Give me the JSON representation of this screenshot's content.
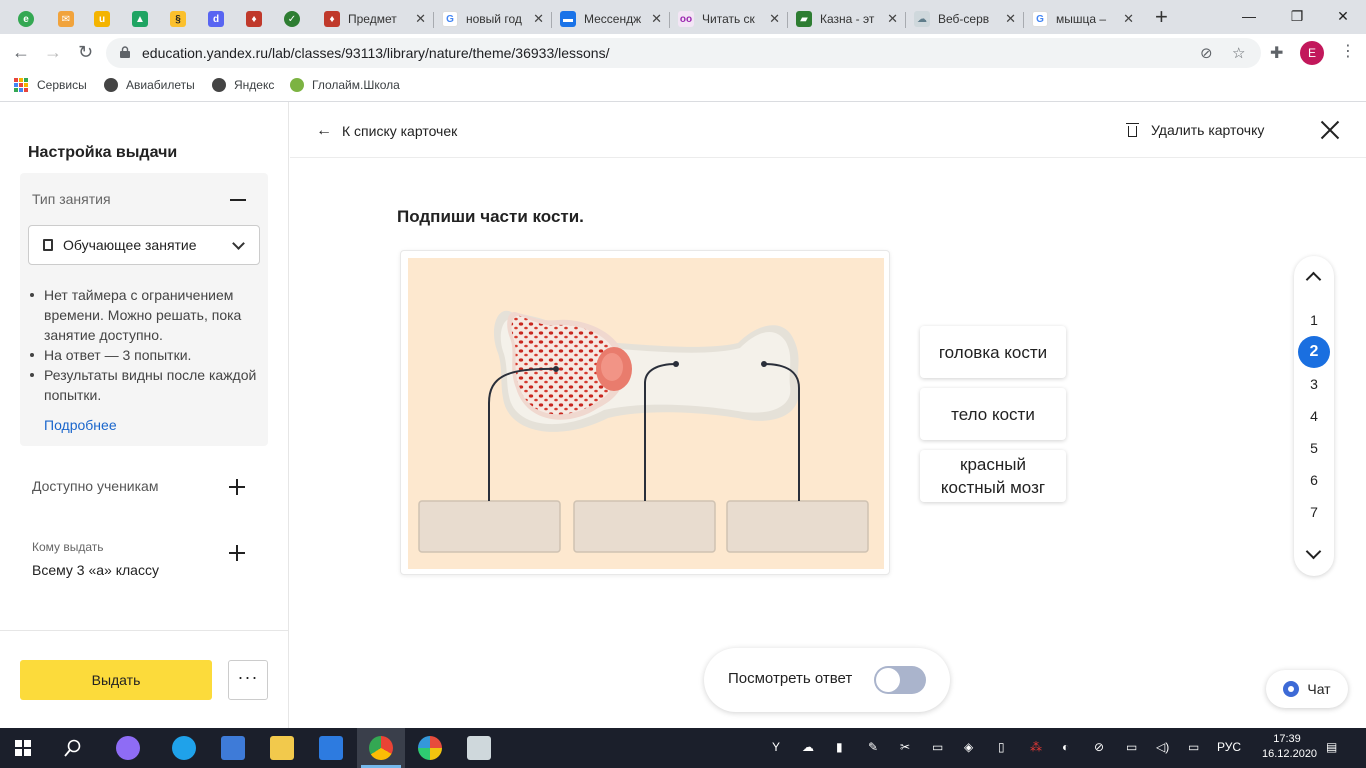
{
  "browser": {
    "tabs": [
      {
        "title": "",
        "icon": "green-e-icon",
        "color": "#34a853"
      },
      {
        "title": "",
        "icon": "mail-icon",
        "color": "#f1a33c"
      },
      {
        "title": "",
        "icon": "uchi-icon",
        "color": "#f4b400"
      },
      {
        "title": "",
        "icon": "drive-icon",
        "color": "#1fa463"
      },
      {
        "title": "",
        "icon": "yellow-s-icon",
        "color": "#fbc02d"
      },
      {
        "title": "",
        "icon": "discord-icon",
        "color": "#5865f2"
      },
      {
        "title": "",
        "icon": "emblem-icon",
        "color": "#c0392b"
      },
      {
        "title": "",
        "icon": "check-icon",
        "color": "#2e7d32"
      },
      {
        "title": "Предмет",
        "icon": "emblem-icon",
        "color": "#c0392b"
      },
      {
        "title": "новый год",
        "icon": "google-icon",
        "color": "#4285f4"
      },
      {
        "title": "Мессендж",
        "icon": "chat-icon",
        "color": "#1a73e8"
      },
      {
        "title": "Читать ск",
        "icon": "glasses-icon",
        "color": "#9c27b0"
      },
      {
        "title": "Казна - эт",
        "icon": "book-icon",
        "color": "#2e7d32"
      },
      {
        "title": "Веб-серв",
        "icon": "cloud-icon",
        "color": "#90a4ae"
      },
      {
        "title": "мышца –",
        "icon": "google-icon",
        "color": "#4285f4"
      }
    ],
    "url": "education.yandex.ru/lab/classes/93113/library/nature/theme/36933/lessons/",
    "profile_letter": "E",
    "bookmarks": [
      {
        "label": "Сервисы",
        "color": "#e8453c"
      },
      {
        "label": "Авиабилеты",
        "color": "#444444"
      },
      {
        "label": "Яндекс",
        "color": "#444444"
      },
      {
        "label": "Глолайм.Школа",
        "color": "#7cb342"
      }
    ]
  },
  "sidebar": {
    "title": "Настройка выдачи",
    "type_label": "Тип занятия",
    "type_value": "Обучающее занятие",
    "bullets": [
      "Нет таймера с ограничением времени. Можно решать, пока занятие доступно.",
      "На ответ — 3 попытки.",
      "Результаты видны после каждой попытки."
    ],
    "more_link": "Подробнее",
    "available_label": "Доступно ученикам",
    "who_label": "Кому выдать",
    "who_value": "Всему 3 «а» классу",
    "issue_button": "Выдать",
    "more_button": "···"
  },
  "main": {
    "back_label": "К списку карточек",
    "delete_label": "Удалить карточку",
    "task_title": "Подпиши части кости.",
    "words": [
      "головка кости",
      "тело кости",
      "красный костный мозг"
    ],
    "pages": [
      "1",
      "2",
      "3",
      "4",
      "5",
      "6",
      "7"
    ],
    "active_page": "2",
    "show_answer_label": "Посмотреть ответ",
    "show_answer_on": false,
    "chat_label": "Чат"
  },
  "taskbar": {
    "language": "РУС",
    "time": "17:39",
    "date": "16.12.2020"
  }
}
